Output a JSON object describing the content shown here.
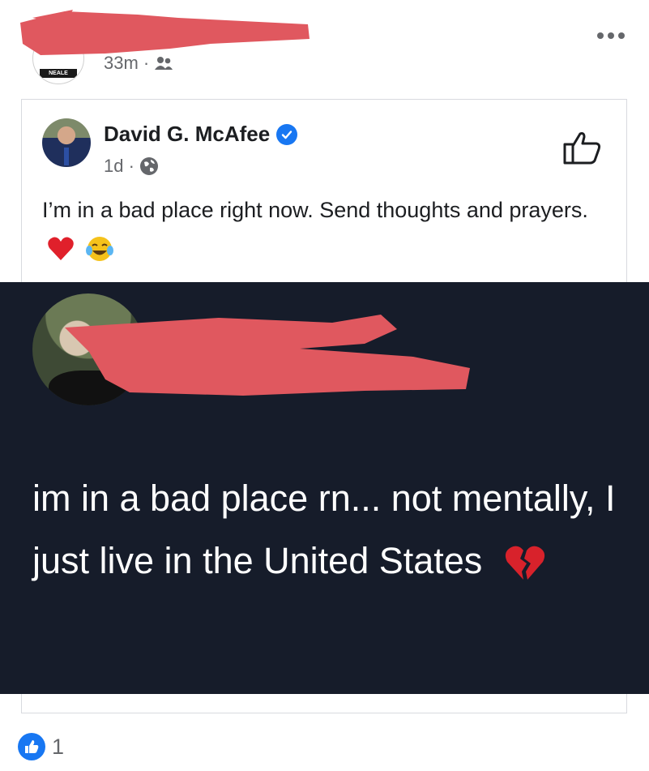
{
  "top_post": {
    "meta": "33m ·",
    "audience_icon": "friends-icon",
    "menu_icon": "more-options-icon",
    "avatar_text": "NEALE"
  },
  "shared_post": {
    "author": "David G. McAfee",
    "verified_icon": "verified-badge-icon",
    "meta": "1d ·",
    "audience_icon": "globe-icon",
    "text": "I’m in a bad place right now. Send thoughts and prayers.",
    "emojis": [
      "red-heart-emoji",
      "tears-of-joy-emoji"
    ],
    "like_icon": "thumbs-up-outline-icon"
  },
  "tweet": {
    "text": "im in a bad place rn... not mentally, I just live in the United States",
    "emoji": "broken-heart-emoji"
  },
  "reactions": {
    "icon": "like-reaction-icon",
    "count": "1"
  },
  "colors": {
    "accent": "#1877f2",
    "tweet_bg": "#161c2a",
    "redaction": "#e0585f",
    "muted_text": "#65676b"
  }
}
